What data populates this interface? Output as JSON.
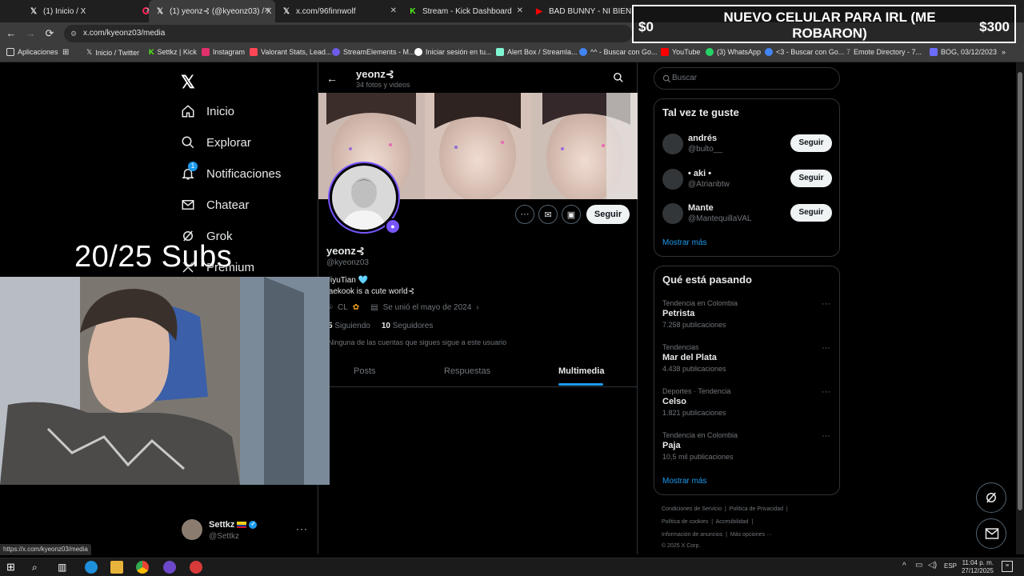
{
  "browser": {
    "tabs": [
      {
        "title": "(1) Inicio / X",
        "icon": "x-logo"
      },
      {
        "title": "(1) yeonz⊰ (@kyeonz03) / X",
        "icon": "x-logo",
        "active": true
      },
      {
        "title": "x.com/96finnwolf",
        "icon": "x-logo"
      },
      {
        "title": "Stream - Kick Dashboard",
        "icon": "kick-logo"
      },
      {
        "title": "BAD BUNNY - NI BIEN NI MAL",
        "icon": "youtube-logo"
      }
    ],
    "url": "x.com/kyeonz03/media",
    "bookmarks": [
      {
        "label": "Aplicaciones",
        "color": "#ffffff"
      },
      {
        "label": "Inicio / Twitter",
        "color": "#ffffff"
      },
      {
        "label": "Settkz | Kick",
        "color": "#53fc18"
      },
      {
        "label": "Instagram",
        "color": "#e1306c"
      },
      {
        "label": "Valorant Stats, Lead...",
        "color": "#ff4655"
      },
      {
        "label": "StreamElements - M...",
        "color": "#6c5ce7"
      },
      {
        "label": "Iniciar sesión en tu...",
        "color": "#ffffff"
      },
      {
        "label": "Alert Box / Streamla...",
        "color": "#80f5d2"
      },
      {
        "label": "^^ - Buscar con Go...",
        "color": "#4285f4"
      },
      {
        "label": "YouTube",
        "color": "#ff0000"
      },
      {
        "label": "(3) WhatsApp",
        "color": "#25d366"
      },
      {
        "label": "<3 - Buscar con Go...",
        "color": "#4285f4"
      },
      {
        "label": "Emote Directory - 7...",
        "color": "#aaaaaa"
      },
      {
        "label": "BOG, 03/12/2023",
        "color": "#6c6cff"
      }
    ],
    "status_url": "https://x.com/kyeonz03/media"
  },
  "overlay": {
    "goal_title": "NUEVO CELULAR PARA IRL (ME ROBARON)",
    "goal_start": "$0",
    "goal_end": "$300",
    "subs_goal": "20/25 Subs"
  },
  "x_nav": {
    "items": [
      {
        "label": "Inicio",
        "icon": "home-icon"
      },
      {
        "label": "Explorar",
        "icon": "search-icon"
      },
      {
        "label": "Notificaciones",
        "icon": "bell-icon",
        "badge": "1"
      },
      {
        "label": "Chatear",
        "icon": "mail-icon"
      },
      {
        "label": "Grok",
        "icon": "grok-icon"
      },
      {
        "label": "Premium",
        "icon": "x-icon"
      }
    ],
    "account": {
      "name": "Settkz",
      "handle": "@Settkz"
    }
  },
  "profile": {
    "header_name": "yeonz⊰",
    "header_count": "34 fotos y videos",
    "name": "yeonz⊰",
    "handle": "@kyeonz03",
    "bio_line1": "JiyuTian 🩵",
    "bio_line2": "taekook is a cute world⊰",
    "location": "CL",
    "joined": "Se unió el mayo de 2024",
    "following_count": "5",
    "following_label": "Siguiendo",
    "followers_count": "10",
    "followers_label": "Seguidores",
    "no_common": "Ninguna de las cuentas que sigues sigue a este usuario",
    "follow_button": "Seguir",
    "tabs": [
      "Posts",
      "Respuestas",
      "Multimedia"
    ],
    "active_tab": "Multimedia"
  },
  "sidebar": {
    "search_placeholder": "Buscar",
    "suggest_title": "Tal vez te guste",
    "suggestions": [
      {
        "name": "andrés",
        "handle": "@bulto__",
        "button": "Seguir"
      },
      {
        "name": "• aki •",
        "handle": "@Atrianbtw",
        "button": "Seguir"
      },
      {
        "name": "Mante",
        "handle": "@MantequillaVAL",
        "button": "Seguir"
      }
    ],
    "show_more": "Mostrar más",
    "trends_title": "Qué está pasando",
    "trends": [
      {
        "context": "Tendencia en Colombia",
        "name": "Petrista",
        "count": "7.258 publicaciones"
      },
      {
        "context": "Tendencias",
        "name": "Mar del Plata",
        "count": "4.438 publicaciones"
      },
      {
        "context": "Deportes · Tendencia",
        "name": "Celso",
        "count": "1.821 publicaciones"
      },
      {
        "context": "Tendencia en Colombia",
        "name": "Paja",
        "count": "10,5 mil publicaciones"
      }
    ],
    "trends_more": "Mostrar más",
    "footer": {
      "line1": [
        "Condiciones de Servicio",
        "Política de Privacidad"
      ],
      "line2": [
        "Política de cookies",
        "Accesibilidad"
      ],
      "line3": [
        "Información de anuncios",
        "Más opciones ···"
      ],
      "copyright": "© 2025 X Corp."
    }
  },
  "taskbar": {
    "language": "ESP",
    "time": "11:04 p. m.",
    "date": "27/12/2025"
  },
  "colors": {
    "accent": "#1d9bf0",
    "verified": "#1d9bf0",
    "avatar_ring": "#7856ff"
  }
}
